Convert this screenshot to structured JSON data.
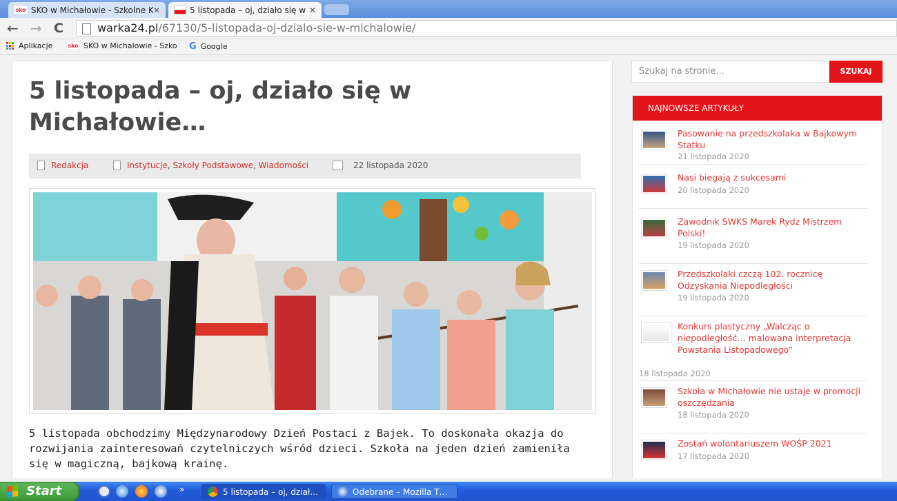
{
  "browser": {
    "tabs": [
      {
        "label": "SKO w Michałowie - Szkolne K",
        "favicon": "sko-favicon"
      },
      {
        "label": "5 listopada – oj, działo się w",
        "favicon": "flag-favicon",
        "active": true
      }
    ],
    "close_glyph": "✕",
    "url_host": "warka24.pl",
    "url_path": "/67130/5-listopada-oj-dzialo-sie-w-michalowie/",
    "nav": {
      "back": "←",
      "forward": "→",
      "reload": "C"
    },
    "bookmarks": [
      {
        "label": "Aplikacje",
        "icon": "apps-grid-icon"
      },
      {
        "label": "SKO w Michałowie - Szko",
        "icon": "sko-favicon"
      },
      {
        "label": "Google",
        "icon": "google-icon"
      }
    ],
    "sko_badge": "sko"
  },
  "article": {
    "title": "5 listopada – oj, działo się w Michałowie…",
    "author": "Redakcja",
    "categories": [
      "Instytucje",
      "Szkoły Podstawowe",
      "Wiadomości"
    ],
    "category_separator": ", ",
    "date": "22 listopada 2020",
    "body": "5 listopada obchodzimy Międzynarodowy Dzień Postaci z Bajek. To doskonała okazja do rozwijania zainteresowań czytelniczych wśród dzieci. Szkoła na jeden dzień zamieniła się w magiczną, bajkową krainę."
  },
  "sidebar": {
    "search_placeholder": "Szukaj na stronie...",
    "search_button": "SZUKAJ",
    "widget_title": "NAJNOWSZE ARTYKUŁY",
    "posts": [
      {
        "title": "Pasowanie na przedszkolaka w Bajkowym Statku",
        "date": "21 listopada 2020"
      },
      {
        "title": "Nasi biegają z sukcesami",
        "date": "20 listopada 2020"
      },
      {
        "title": "Zawodnik SWKS Marek Rydz Mistrzem Polski!",
        "date": "19 listopada 2020"
      },
      {
        "title": "Przedszkolaki czczą 102. rocznicę Odzyskania Niepodległości",
        "date": "19 listopada 2020"
      },
      {
        "title": "Konkurs plastyczny „Walcząc o niepodległość… malowana interpretacja Powstania Listopadowego”",
        "date": "18 listopada 2020"
      },
      {
        "title": "Szkoła w Michałowie nie ustaje w promocji oszczędzania",
        "date": "18 listopada 2020"
      },
      {
        "title": "Zostań wolontariuszem WOŚP 2021",
        "date": "17 listopada 2020"
      }
    ]
  },
  "taskbar": {
    "start_label": "Start",
    "overflow": "»",
    "windows": [
      {
        "label": "5 listopada – oj, dział…",
        "icon": "chrome-icon"
      },
      {
        "label": "Odebrane – Mozilla T…",
        "icon": "thunderbird-icon"
      }
    ]
  },
  "colors": {
    "accent": "#e4141b",
    "link": "#d2322d",
    "title": "#4a4a4a",
    "taskbar": "#245edb",
    "start": "#3c9a38"
  }
}
